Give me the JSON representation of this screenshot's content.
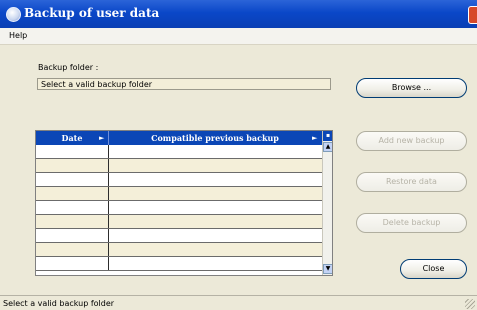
{
  "window": {
    "title": "Backup of user data"
  },
  "menu": {
    "help_label": "Help"
  },
  "folder": {
    "label": "Backup folder :",
    "value": "Select a valid backup folder"
  },
  "buttons": {
    "browse": "Browse ...",
    "add_new_backup": "Add new backup",
    "restore_data": "Restore data",
    "delete_backup": "Delete backup",
    "close": "Close"
  },
  "table": {
    "columns": [
      "Date",
      "Compatible previous backup"
    ],
    "rows": [
      [
        "",
        ""
      ],
      [
        "",
        ""
      ],
      [
        "",
        ""
      ],
      [
        "",
        ""
      ],
      [
        "",
        ""
      ],
      [
        "",
        ""
      ],
      [
        "",
        ""
      ],
      [
        "",
        ""
      ],
      [
        "",
        ""
      ]
    ]
  },
  "status": {
    "text": "Select a valid backup folder"
  }
}
